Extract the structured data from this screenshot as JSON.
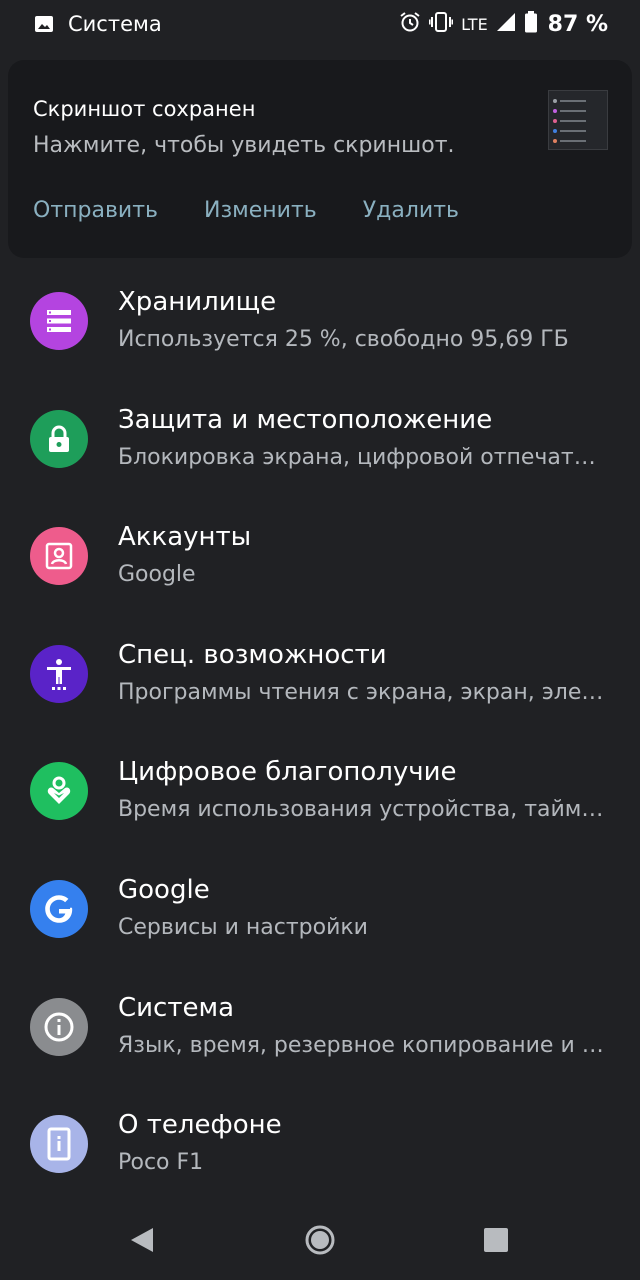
{
  "status_bar": {
    "app_name": "Система",
    "network": "LTE",
    "battery": "87 %",
    "icons": [
      "image-icon",
      "alarm-icon",
      "vibrate-icon",
      "signal-icon",
      "battery-icon"
    ]
  },
  "notification": {
    "title": "Скриншот сохранен",
    "text": "Нажмите, чтобы увидеть скриншот.",
    "actions": [
      "Отправить",
      "Изменить",
      "Удалить"
    ]
  },
  "settings": [
    {
      "title": "Хранилище",
      "subtitle": "Используется 25 %, свободно 95,69 ГБ",
      "icon": "storage-icon",
      "color": "#b444e0"
    },
    {
      "title": "Защита и местоположение",
      "subtitle": "Блокировка экрана, цифровой отпечаток пальца",
      "icon": "lock-icon",
      "color": "#1e9e5a"
    },
    {
      "title": "Аккаунты",
      "subtitle": "Google",
      "icon": "account-icon",
      "color": "#ee5c8c"
    },
    {
      "title": "Спец. возможности",
      "subtitle": "Программы чтения с экрана, экран, элементы управления",
      "icon": "accessibility-icon",
      "color": "#5a23c8"
    },
    {
      "title": "Цифровое благополучие",
      "subtitle": "Время использования устройства, таймеры приложений",
      "icon": "wellbeing-icon",
      "color": "#1fbf60"
    },
    {
      "title": "Google",
      "subtitle": "Сервисы и настройки",
      "icon": "google-icon",
      "color": "#3580ee"
    },
    {
      "title": "Система",
      "subtitle": "Язык, время, резервное копирование и обновления",
      "icon": "info-icon",
      "color": "#8a8c8f"
    },
    {
      "title": "О телефоне",
      "subtitle": "Poco F1",
      "icon": "phone-info-icon",
      "color": "#a8b4e8"
    }
  ],
  "nav": [
    "back-icon",
    "home-icon",
    "recents-icon"
  ]
}
